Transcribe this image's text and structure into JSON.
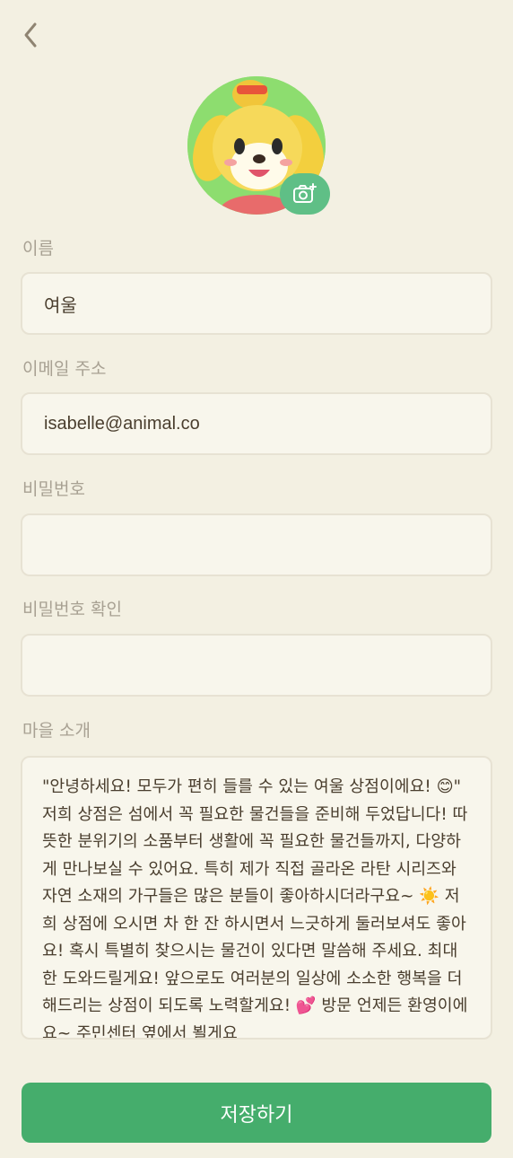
{
  "header": {
    "back_icon": "chevron-left-icon"
  },
  "profile": {
    "avatar_alt": "Isabelle avatar",
    "camera_icon": "camera-plus-icon"
  },
  "form": {
    "name": {
      "label": "이름",
      "value": "여울"
    },
    "email": {
      "label": "이메일 주소",
      "value": "isabelle@animal.co"
    },
    "password": {
      "label": "비밀번호",
      "value": ""
    },
    "password_confirm": {
      "label": "비밀번호 확인",
      "value": ""
    },
    "intro": {
      "label": "마을 소개",
      "value": "\"안녕하세요! 모두가 편히 들를 수 있는 여울 상점이에요! 😊\" 저희 상점은 섬에서 꼭 필요한 물건들을 준비해 두었답니다! 따뜻한 분위기의 소품부터 생활에 꼭 필요한 물건들까지, 다양하게 만나보실 수 있어요. 특히 제가 직접 골라온 라탄 시리즈와 자연 소재의 가구들은 많은 분들이 좋아하시더라구요~ ☀️ 저희 상점에 오시면 차 한 잔 하시면서 느긋하게 둘러보셔도 좋아요! 혹시 특별히 찾으시는 물건이 있다면 말씀해 주세요. 최대한 도와드릴게요! 앞으로도 여러분의 일상에 소소한 행복을 더해드리는 상점이 되도록 노력할게요! 💕 방문 언제든 환영이에요~ 주민센터 옆에서 뵐게요"
    }
  },
  "actions": {
    "save_label": "저장하기"
  },
  "colors": {
    "background": "#f3f0e2",
    "accent": "#45ad6c",
    "camera_badge": "#5fbf86",
    "label": "#a8a193"
  }
}
